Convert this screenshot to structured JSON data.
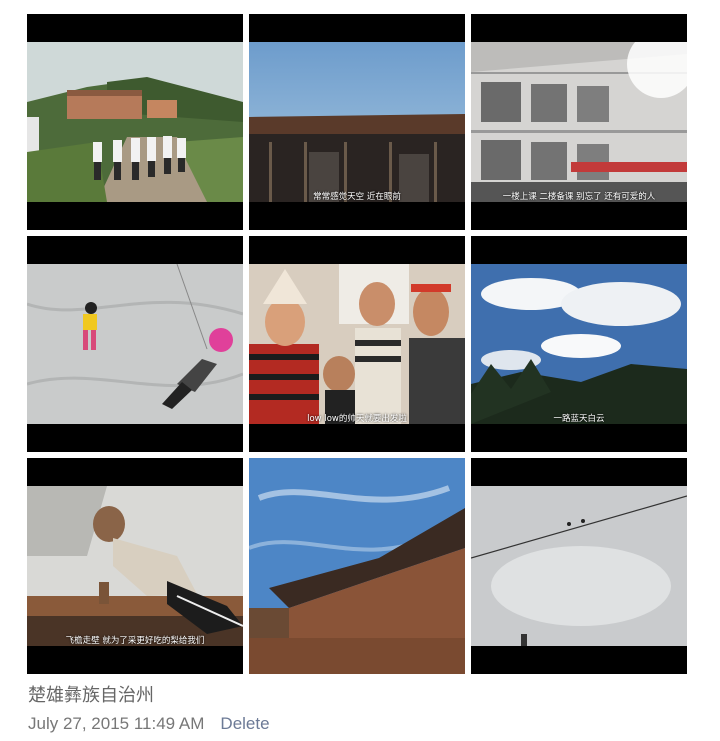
{
  "top_text": "· · · · · · · ·",
  "tiles": [
    {
      "subtitle": ""
    },
    {
      "subtitle": "常常感觉天空 近在眼前"
    },
    {
      "subtitle": "一楼上课 二楼备课 别忘了 还有可爱的人"
    },
    {
      "subtitle": ""
    },
    {
      "subtitle": "low low的帅天就要出发啦"
    },
    {
      "subtitle": "一路蓝天白云"
    },
    {
      "subtitle": "飞檐走壁 就为了采更好吃的梨给我们"
    },
    {
      "subtitle": ""
    },
    {
      "subtitle": ""
    }
  ],
  "post": {
    "location": "楚雄彝族自治州",
    "timestamp": "July 27, 2015 11:49 AM",
    "delete_label": "Delete"
  }
}
